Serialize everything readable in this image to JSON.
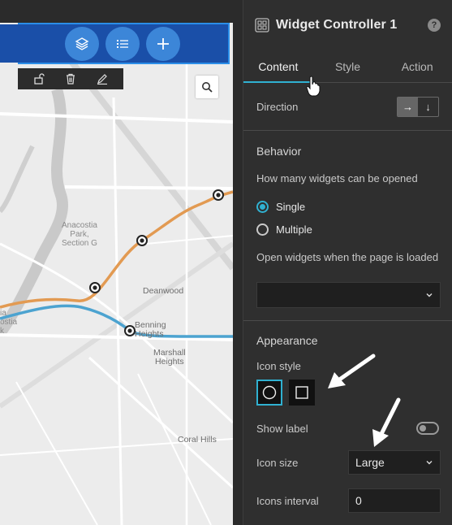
{
  "map": {
    "labels": {
      "anacostia_park": "Anacostia\nPark,\nSection G",
      "deanwood": "Deanwood",
      "benning_heights": "Benning\nHeights",
      "marshall_heights": "Marshall\nHeights",
      "coral_hills": "Coral Hills",
      "left_cut_1": "ia",
      "left_cut_2": "ostia",
      "left_cut_3": "k"
    },
    "controller_icons": [
      "layers-icon",
      "list-icon",
      "plus-icon"
    ],
    "edit_tools": [
      "unlock-icon",
      "trash-icon",
      "pencil-icon"
    ],
    "colors": {
      "bar": "#1a4fa8",
      "bar_border": "#2b8ee8",
      "circle": "#3c86d8",
      "orange_line": "#e29a52",
      "blue_line": "#4ca3d0"
    }
  },
  "panel": {
    "title": "Widget Controller 1",
    "help": "?",
    "tabs": [
      {
        "label": "Content",
        "active": true
      },
      {
        "label": "Style",
        "active": false
      },
      {
        "label": "Action",
        "active": false
      }
    ],
    "direction": {
      "label": "Direction",
      "options": [
        "→",
        "↓"
      ],
      "selected": 0
    },
    "behavior": {
      "title": "Behavior",
      "question": "How many widgets can be opened",
      "options": [
        "Single",
        "Multiple"
      ],
      "selected": "Single",
      "open_on_load_label": "Open widgets when the page is loaded",
      "open_on_load_value": ""
    },
    "appearance": {
      "title": "Appearance",
      "icon_style_label": "Icon style",
      "icon_styles": [
        "circle",
        "square"
      ],
      "icon_style_selected": "circle",
      "show_label": "Show label",
      "show_label_on": false,
      "icon_size_label": "Icon size",
      "icon_size_value": "Large",
      "icons_interval_label": "Icons interval",
      "icons_interval_value": "0"
    },
    "accent": "#30b1d1"
  }
}
